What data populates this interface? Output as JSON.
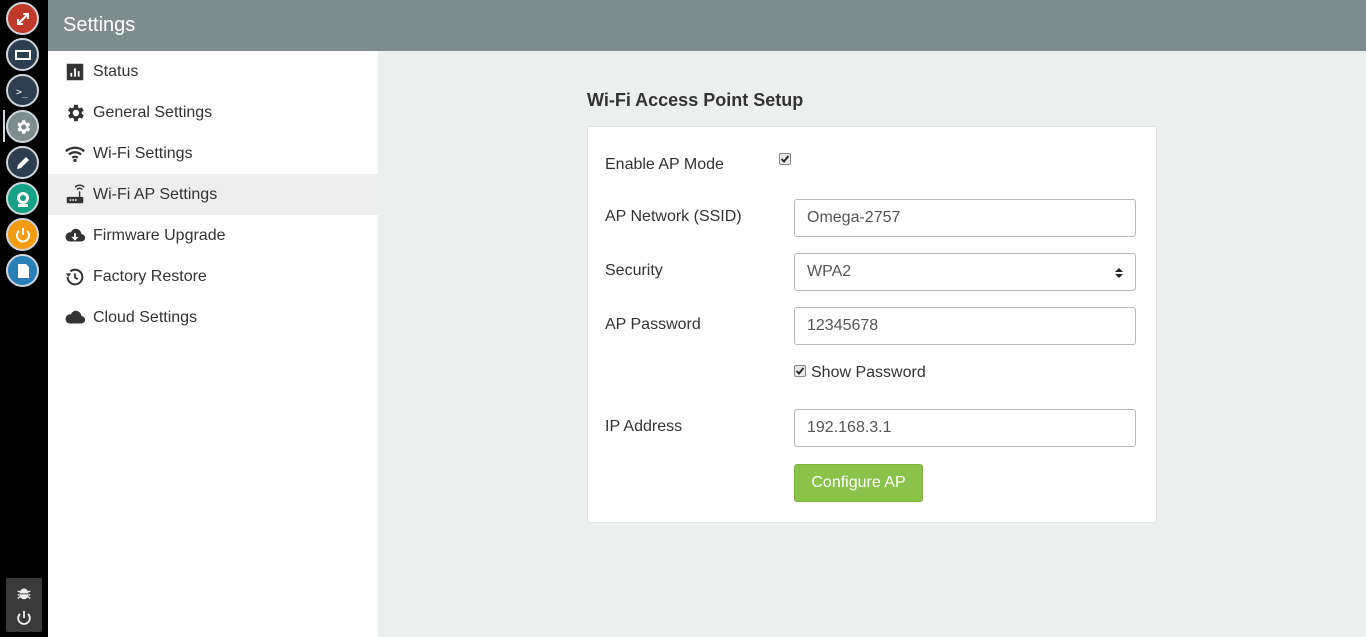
{
  "header": {
    "title": "Settings"
  },
  "dock": {
    "apps": [
      {
        "name": "app-installer-icon",
        "color": "#c0392b"
      },
      {
        "name": "window-icon",
        "color": "#2c3e50"
      },
      {
        "name": "terminal-icon",
        "color": "#2c3e50",
        "glyph": ">_"
      },
      {
        "name": "settings-icon",
        "color": "#7f8c8d"
      },
      {
        "name": "editor-icon",
        "color": "#2c3e50"
      },
      {
        "name": "camera-icon",
        "color": "#16a085"
      },
      {
        "name": "power-icon",
        "color": "#f39c12"
      },
      {
        "name": "storage-icon",
        "color": "#2980b9"
      }
    ],
    "bottom": [
      "bug-icon",
      "shutdown-icon"
    ]
  },
  "sidebar": {
    "items": [
      {
        "label": "Status",
        "icon": "bar-chart-icon"
      },
      {
        "label": "General Settings",
        "icon": "gear-icon"
      },
      {
        "label": "Wi-Fi Settings",
        "icon": "wifi-icon"
      },
      {
        "label": "Wi-Fi AP Settings",
        "icon": "router-icon",
        "active": true
      },
      {
        "label": "Firmware Upgrade",
        "icon": "cloud-download-icon"
      },
      {
        "label": "Factory Restore",
        "icon": "history-icon"
      },
      {
        "label": "Cloud Settings",
        "icon": "cloud-icon"
      }
    ]
  },
  "main": {
    "title": "Wi-Fi Access Point Setup",
    "form": {
      "enable_ap_label": "Enable AP Mode",
      "enable_ap_checked": true,
      "ssid_label": "AP Network (SSID)",
      "ssid_value": "Omega-2757",
      "security_label": "Security",
      "security_value": "WPA2",
      "password_label": "AP Password",
      "password_value": "12345678",
      "show_password_label": "Show Password",
      "show_password_checked": true,
      "ip_label": "IP Address",
      "ip_value": "192.168.3.1",
      "submit_label": "Configure AP"
    }
  },
  "colors": {
    "accent": "#8bc34a",
    "header_bg": "#7f8c8d",
    "sidebar_active": "#eeeeee"
  }
}
